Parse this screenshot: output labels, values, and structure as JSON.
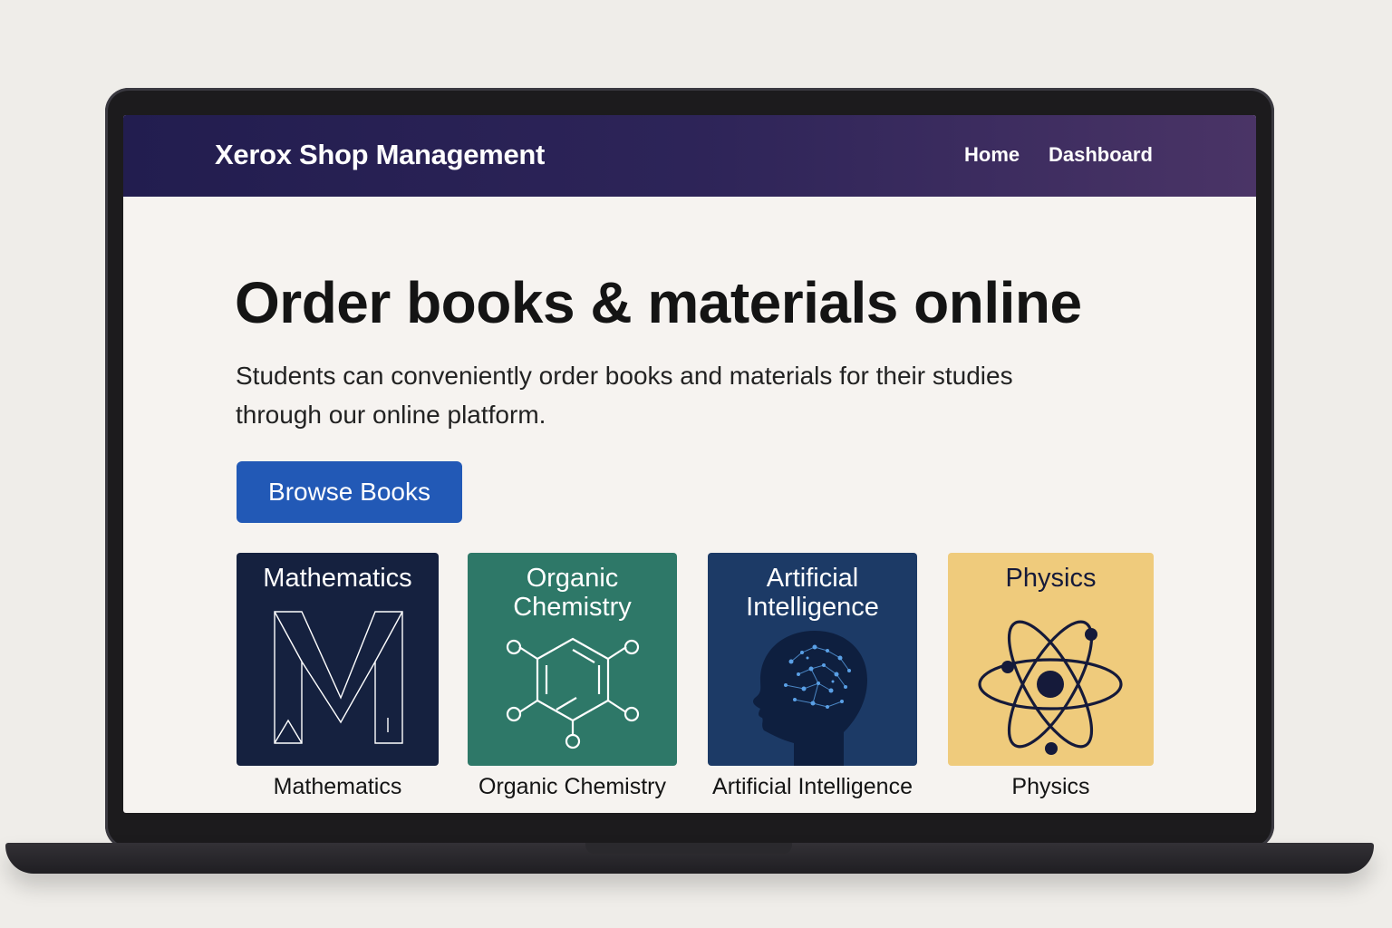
{
  "navbar": {
    "brand": "Xerox Shop Management",
    "links": [
      "Home",
      "Dashboard"
    ]
  },
  "hero": {
    "title": "Order books & materials online",
    "subtitle": "Students can conveniently order books and materials for their studies through our online platform.",
    "cta_label": "Browse Books"
  },
  "categories": [
    {
      "title": "Mathematics",
      "caption": "Mathematics",
      "color": "#15213f",
      "icon": "letter-m-icon"
    },
    {
      "title": "Organic Chemistry",
      "caption": "Organic Chemistry",
      "color": "#2e7868",
      "icon": "benzene-molecule-icon"
    },
    {
      "title": "Artificial Intelligence",
      "caption": "Artificial Intelligence",
      "color": "#1c3a66",
      "icon": "brain-head-icon"
    },
    {
      "title": "Physics",
      "caption": "Physics",
      "color": "#efcb7c",
      "icon": "atom-icon"
    }
  ],
  "colors": {
    "navbar_start": "#221d4f",
    "navbar_end": "#4a3466",
    "accent": "#2259b6",
    "page_background": "#f6f3f0"
  }
}
